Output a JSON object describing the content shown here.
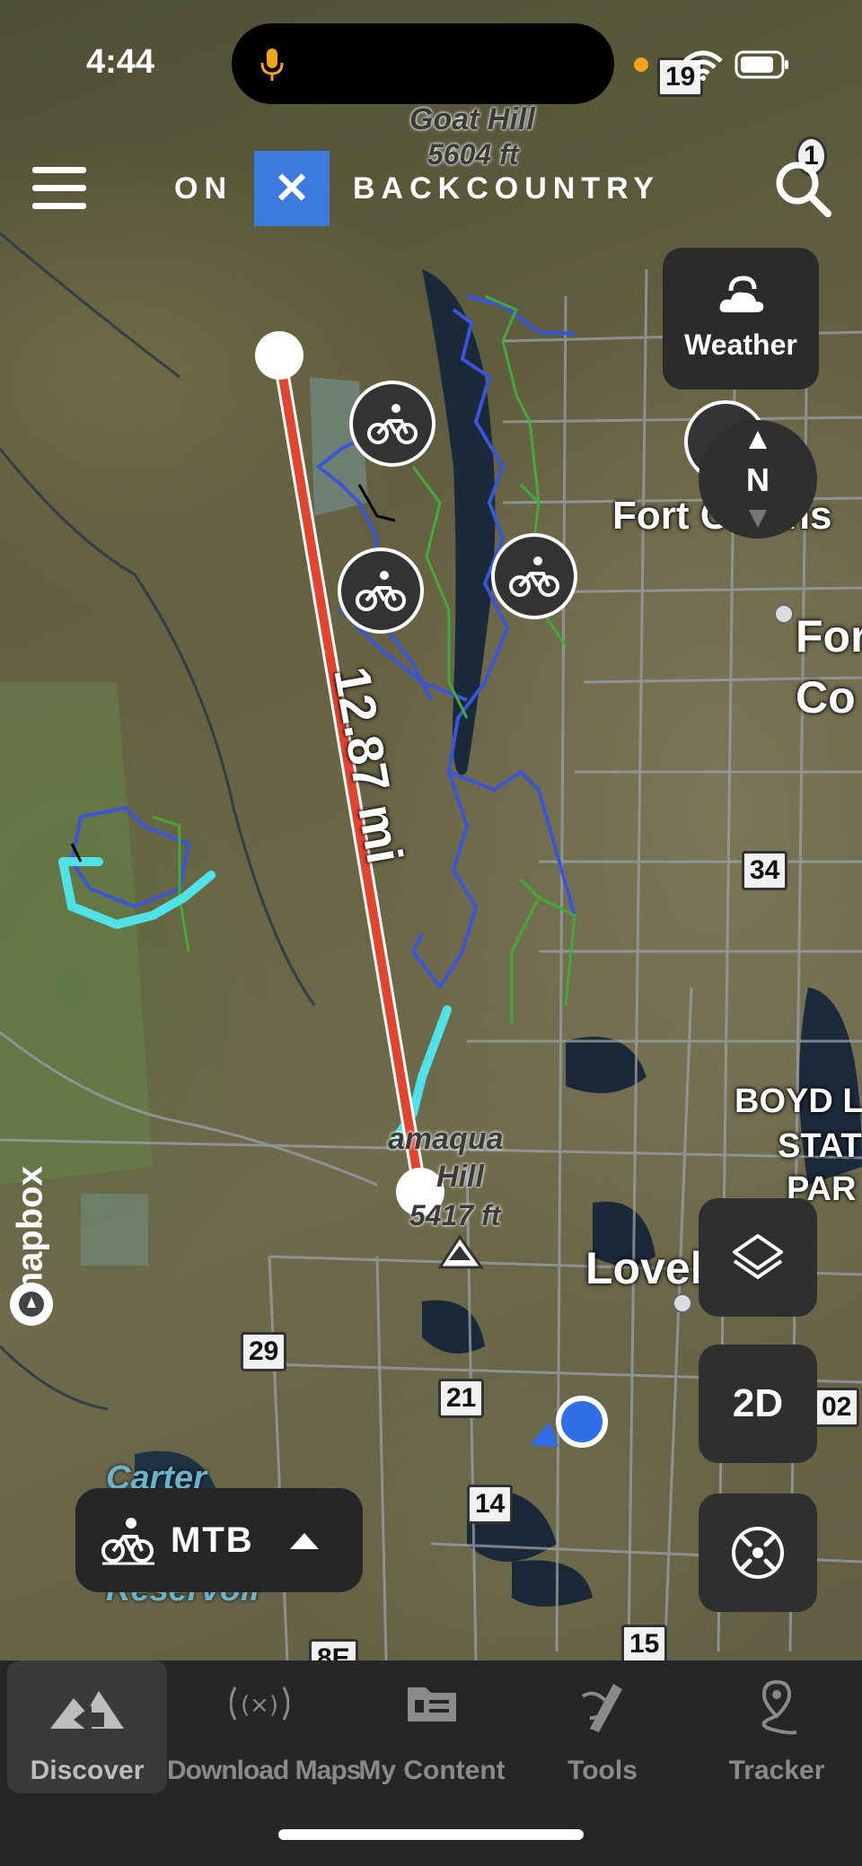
{
  "status_bar": {
    "time": "4:44"
  },
  "header": {
    "logo_left": "ON",
    "logo_mark": "✕",
    "logo_right": "BACKCOUNTRY"
  },
  "map": {
    "labels": {
      "goat_hill": "Goat Hill",
      "goat_hill_elev": "5604 ft",
      "fort_collins_1": "Fort Collins",
      "fort_collins_2a": "For",
      "fort_collins_2b": "Co",
      "kamaqua": "amaqua",
      "hill": "Hill",
      "hill_elev": "5417 ft",
      "loveland": "Lovel",
      "boyd1": "BOYD L",
      "boyd2": "STAT",
      "boyd3": "PAR",
      "carter": "Carter",
      "reservoir": "Reservoir"
    },
    "route_shields": [
      "19",
      "34",
      "29",
      "21",
      "14",
      "15",
      "8E",
      "1",
      "02"
    ],
    "measurement": "12.87 mi",
    "attribution": "mapbox"
  },
  "weather": {
    "label": "Weather"
  },
  "compass": {
    "label": "N"
  },
  "controls": {
    "mode_label": "2D"
  },
  "activity": {
    "label": "MTB"
  },
  "tabs": [
    {
      "label": "Discover",
      "icon": "discover-icon"
    },
    {
      "label": "Download Maps",
      "icon": "download-icon"
    },
    {
      "label": "My Content",
      "icon": "folder-icon"
    },
    {
      "label": "Tools",
      "icon": "tools-icon"
    },
    {
      "label": "Tracker",
      "icon": "tracker-icon"
    }
  ],
  "colors": {
    "measure_line": "#e2452f",
    "trail_blue": "#3a55d8",
    "trail_green": "#44a83a",
    "trail_cyan": "#4fe3e8",
    "logo_blue": "#3d7be0",
    "user_location": "#2f6ee8"
  }
}
